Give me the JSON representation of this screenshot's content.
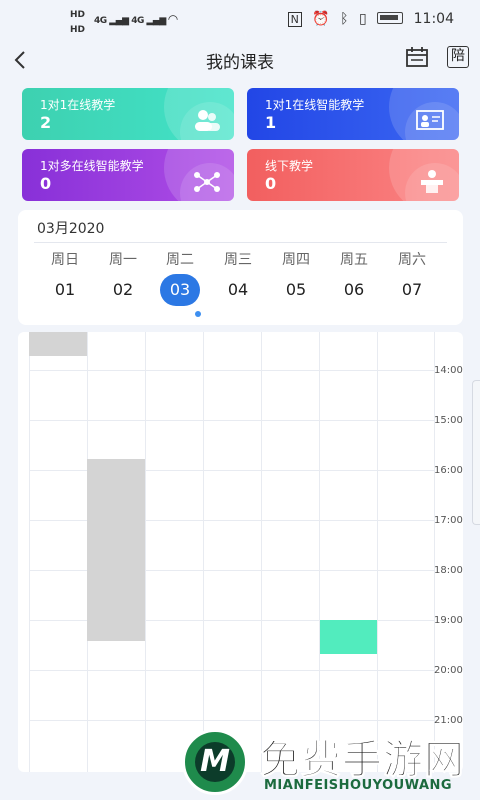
{
  "status_bar": {
    "hd1": "HD",
    "hd2": "HD",
    "net1": "4G",
    "net2": "4G",
    "nfc": "N",
    "time": "11:04"
  },
  "nav": {
    "title": "我的课表",
    "back_icon": "chevron-left-icon",
    "calendar_icon": "calendar-icon",
    "accompany_label": "陪"
  },
  "cards": [
    {
      "label": "1对1在线教学",
      "count": "2",
      "icon": "students-icon",
      "color": "#3dd1b0"
    },
    {
      "label": "1对1在线智能教学",
      "count": "1",
      "icon": "screen-teacher-icon",
      "color": "#2246e6"
    },
    {
      "label": "1对多在线智能教学",
      "count": "0",
      "icon": "network-icon",
      "color": "#8830d8"
    },
    {
      "label": "线下教学",
      "count": "0",
      "icon": "podium-icon",
      "color": "#f25f5f"
    }
  ],
  "week": {
    "month": "03月2020",
    "days": [
      {
        "weekday": "周日",
        "date": "01"
      },
      {
        "weekday": "周一",
        "date": "02"
      },
      {
        "weekday": "周二",
        "date": "03"
      },
      {
        "weekday": "周三",
        "date": "04"
      },
      {
        "weekday": "周四",
        "date": "05"
      },
      {
        "weekday": "周五",
        "date": "06"
      },
      {
        "weekday": "周六",
        "date": "07"
      }
    ],
    "selected_index": 2
  },
  "timetable": {
    "times": [
      "14:00",
      "15:00",
      "16:00",
      "17:00",
      "18:00",
      "19:00",
      "20:00",
      "21:00"
    ],
    "block_colors": {
      "past": "#d4d4d4",
      "upcoming": "#52ecbe"
    }
  },
  "watermark": {
    "title": "免费手游网",
    "subtitle": "MIANFEISHOUYOUWANG",
    "logo_letter": "M"
  }
}
